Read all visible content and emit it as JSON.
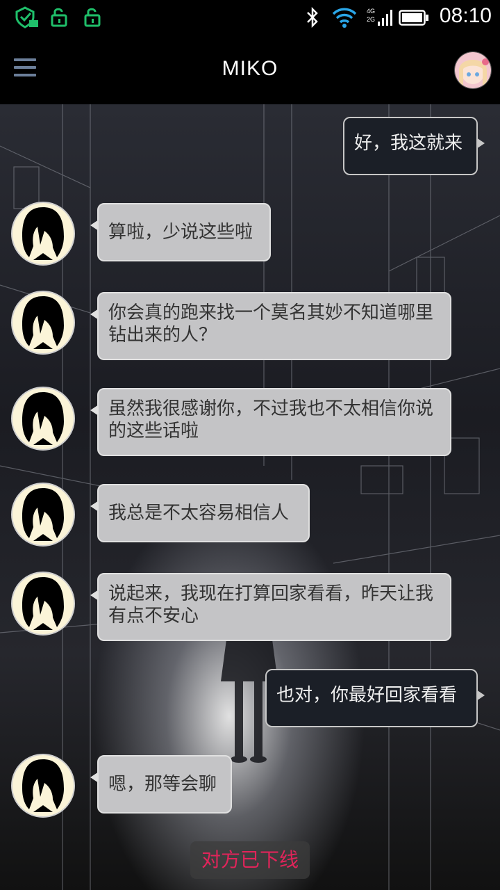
{
  "status_bar": {
    "time": "08:10",
    "network_top": "4G",
    "network_bottom": "2G"
  },
  "app_bar": {
    "title": "MIKO"
  },
  "messages": [
    {
      "side": "out",
      "text": "好，我这就来"
    },
    {
      "side": "in",
      "text": "算啦，少说这些啦"
    },
    {
      "side": "in",
      "text": "你会真的跑来找一个莫名其妙不知道哪里钻出来的人？"
    },
    {
      "side": "in",
      "text": "虽然我很感谢你，不过我也不太相信你说的这些话啦"
    },
    {
      "side": "in",
      "text": "我总是不太容易相信人"
    },
    {
      "side": "in",
      "text": "说起来，我现在打算回家看看，昨天让我有点不安心"
    },
    {
      "side": "out",
      "text": "也对，你最好回家看看"
    },
    {
      "side": "in",
      "text": "嗯，那等会聊"
    }
  ],
  "system_notice": "对方已下线",
  "colors": {
    "status_icon_green": "#1fbf6a",
    "notice_red": "#e0245a",
    "incoming_bubble": "#c4c4c6",
    "outgoing_bubble": "#1b1f27"
  }
}
